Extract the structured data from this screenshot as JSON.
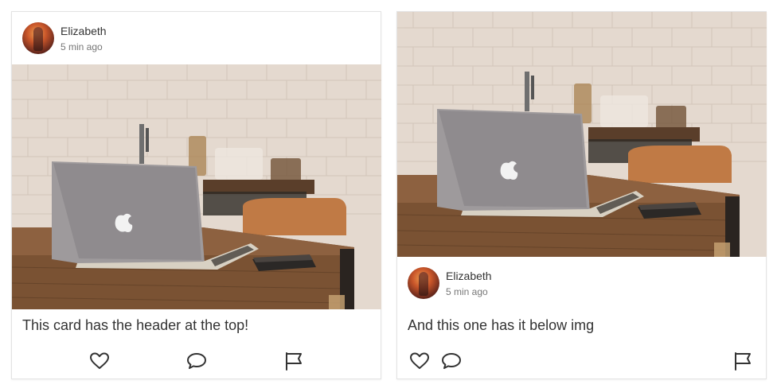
{
  "cards": [
    {
      "author": "Elizabeth",
      "time": "5 min ago",
      "caption": "This card has the header at the top!",
      "icons": [
        "heart-icon",
        "comment-icon",
        "flag-icon"
      ]
    },
    {
      "author": "Elizabeth",
      "time": "5 min ago",
      "caption": "And this one has it below img",
      "icons": [
        "heart-icon",
        "comment-icon",
        "flag-icon"
      ]
    }
  ]
}
